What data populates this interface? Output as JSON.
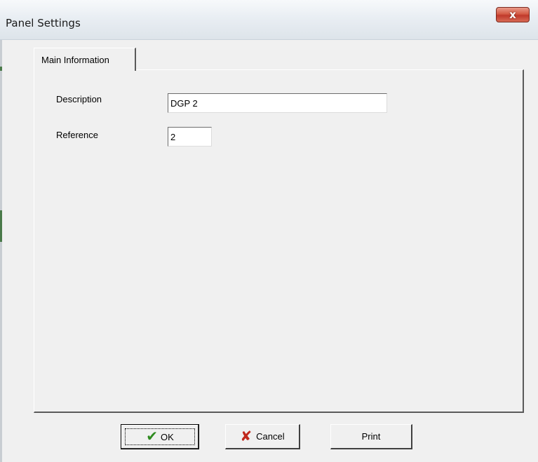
{
  "window": {
    "title": "Panel Settings",
    "close_glyph": "x"
  },
  "tabs": [
    {
      "label": "Main Information",
      "active": true
    }
  ],
  "fields": {
    "description": {
      "label": "Description",
      "value": "DGP 2"
    },
    "reference": {
      "label": "Reference",
      "value": "2"
    }
  },
  "buttons": {
    "ok": {
      "label": "OK",
      "icon": "checkmark-icon"
    },
    "cancel": {
      "label": "Cancel",
      "icon": "red-x-icon"
    },
    "print": {
      "label": "Print"
    }
  },
  "colors": {
    "close_button": "#c0392b",
    "ok_icon": "#2e8b1f",
    "cancel_icon": "#c0281c",
    "dialog_background": "#f0f0f0"
  }
}
